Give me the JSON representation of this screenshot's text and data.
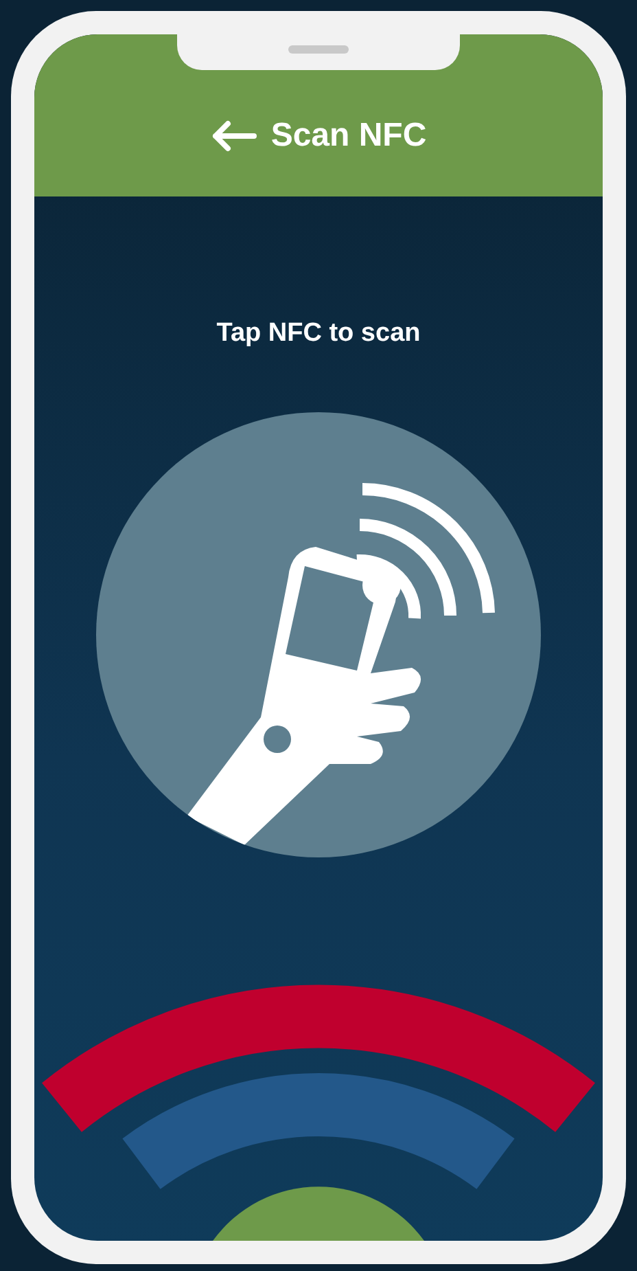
{
  "header": {
    "title": "Scan NFC"
  },
  "body": {
    "instruction": "Tap NFC to scan"
  }
}
